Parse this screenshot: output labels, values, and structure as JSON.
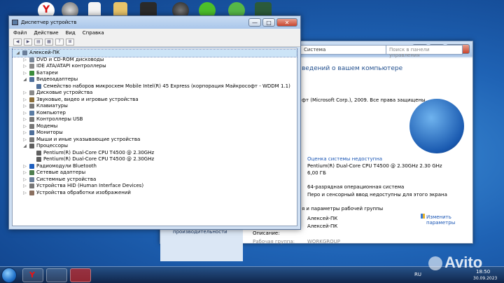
{
  "device_manager": {
    "title": "Диспетчер устройств",
    "menu": [
      "Файл",
      "Действие",
      "Вид",
      "Справка"
    ],
    "tree": [
      {
        "label": "Алексей-ПК",
        "level": 0,
        "expander": "◢",
        "icon_color": "#6a7f9a"
      },
      {
        "label": "DVD и CD-ROM дисководы",
        "level": 1,
        "expander": "▷",
        "icon_color": "#7a8899"
      },
      {
        "label": "IDE ATA/ATAPI контроллеры",
        "level": 1,
        "expander": "▷",
        "icon_color": "#8a8a8a"
      },
      {
        "label": "Батареи",
        "level": 1,
        "expander": "▷",
        "icon_color": "#3b8c3b"
      },
      {
        "label": "Видеоадаптеры",
        "level": 1,
        "expander": "◢",
        "icon_color": "#4f6f9a"
      },
      {
        "label": "Семейство наборов микросхем Mobile Intel(R) 45 Express (корпорация Майкрософт - WDDM 1.1)",
        "level": 2,
        "expander": "",
        "icon_color": "#4f6f9a"
      },
      {
        "label": "Дисковые устройства",
        "level": 1,
        "expander": "▷",
        "icon_color": "#8a8a8a"
      },
      {
        "label": "Звуковые, видео и игровые устройства",
        "level": 1,
        "expander": "▷",
        "icon_color": "#8b6f3b"
      },
      {
        "label": "Клавиатуры",
        "level": 1,
        "expander": "▷",
        "icon_color": "#777777"
      },
      {
        "label": "Компьютер",
        "level": 1,
        "expander": "▷",
        "icon_color": "#5a7ba3"
      },
      {
        "label": "Контроллеры USB",
        "level": 1,
        "expander": "▷",
        "icon_color": "#777777"
      },
      {
        "label": "Модемы",
        "level": 1,
        "expander": "▷",
        "icon_color": "#777777"
      },
      {
        "label": "Мониторы",
        "level": 1,
        "expander": "▷",
        "icon_color": "#4f6f9a"
      },
      {
        "label": "Мыши и иные указывающие устройства",
        "level": 1,
        "expander": "▷",
        "icon_color": "#777777"
      },
      {
        "label": "Процессоры",
        "level": 1,
        "expander": "◢",
        "icon_color": "#5f5f5f"
      },
      {
        "label": "Pentium(R) Dual-Core CPU       T4500  @ 2.30GHz",
        "level": 2,
        "expander": "",
        "icon_color": "#5f5f5f"
      },
      {
        "label": "Pentium(R) Dual-Core CPU       T4500  @ 2.30GHz",
        "level": 2,
        "expander": "",
        "icon_color": "#5f5f5f"
      },
      {
        "label": "Радиомодули Bluetooth",
        "level": 1,
        "expander": "▷",
        "icon_color": "#1f5fbf"
      },
      {
        "label": "Сетевые адаптеры",
        "level": 1,
        "expander": "▷",
        "icon_color": "#4f7f4f"
      },
      {
        "label": "Системные устройства",
        "level": 1,
        "expander": "▷",
        "icon_color": "#6a7f9a"
      },
      {
        "label": "Устройства HID (Human Interface Devices)",
        "level": 1,
        "expander": "▷",
        "icon_color": "#777777"
      },
      {
        "label": "Устройства обработки изображений",
        "level": 1,
        "expander": "▷",
        "icon_color": "#8a6f5f"
      }
    ]
  },
  "system_window": {
    "breadcrumb": "Система",
    "search_placeholder": "Поиск в панели управления",
    "heading": "ведений о вашем компьютере",
    "copyright": "фт (Microsoft Corp.), 2009. Все права защищены.",
    "rating_link": "Оценка системы недоступна",
    "cpu": "Pentium(R) Dual-Core CPU       T4500  @ 2.30GHz   2.30 GHz",
    "ram": "6,00 ГБ",
    "system_type": "64-разрядная операционная система",
    "pen_touch": "Перо и сенсорный ввод недоступны для этого экрана",
    "section_name": "я и параметры рабочей группы",
    "computer_name": "Алексей-ПК",
    "full_name": "Алексей-ПК",
    "description_label": "Описание:",
    "workgroup_label": "Рабочая группа:",
    "workgroup": "WORKGROUP",
    "change_link_line1": "Изменить",
    "change_link_line2": "параметры",
    "left_link": "производительности"
  },
  "taskbar": {
    "lang": "RU",
    "time": "18:50",
    "date": "30.09.2023"
  },
  "watermark": "Avito",
  "colors": {
    "link": "#1a56b5",
    "selection": "#cce4f7"
  }
}
